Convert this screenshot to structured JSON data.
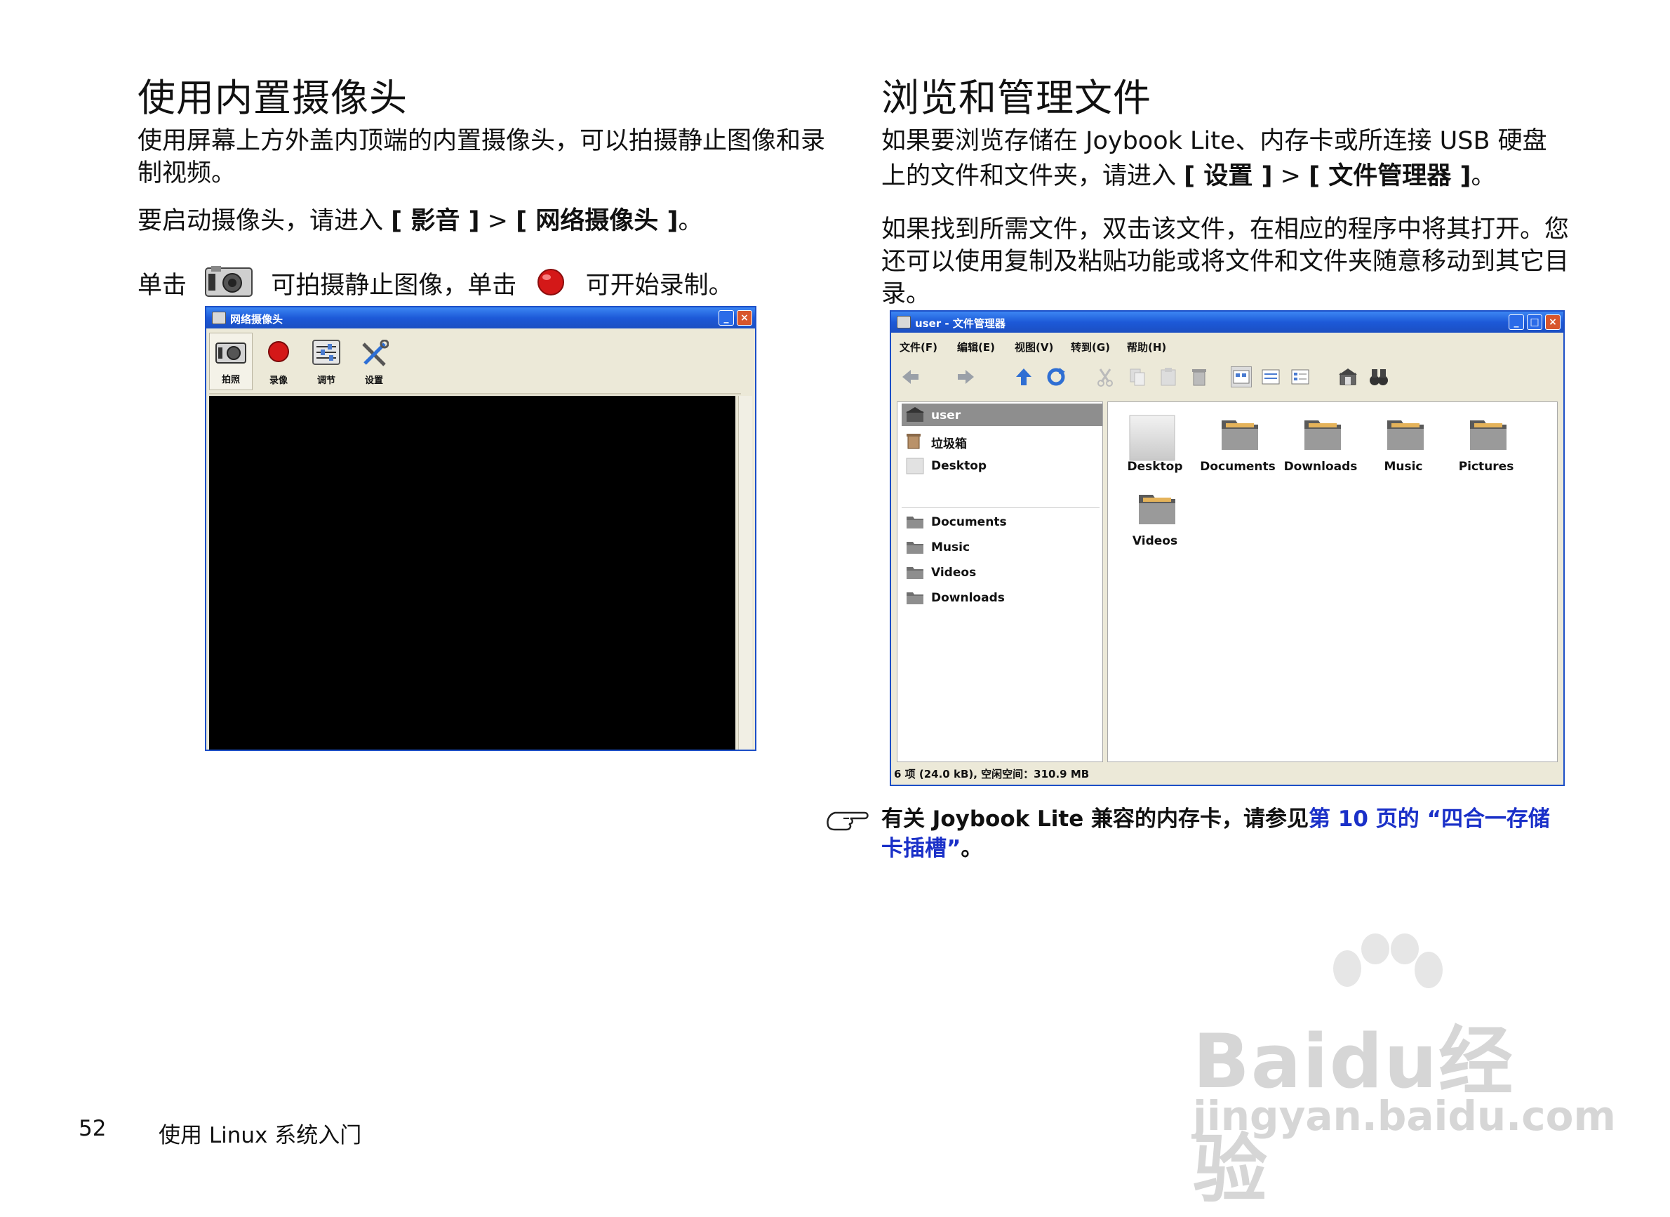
{
  "left": {
    "heading": "使用内置摄像头",
    "intro": "使用屏幕上方外盖内顶端的内置摄像头，可以拍摄静止图像和录制视频。",
    "start_prefix": "要启动摄像头，请进入 ",
    "start_menu_1": "[ 影音 ]",
    "start_sep": " > ",
    "start_menu_2": "[ 网络摄像头 ]",
    "start_suffix": "。",
    "click_1": "单击",
    "click_2": "可拍摄静止图像，单击",
    "click_3": "可开始录制。"
  },
  "webcam_window": {
    "title": "网络摄像头",
    "buttons": [
      "拍照",
      "录像",
      "调节",
      "设置"
    ],
    "colors": {
      "titlebar": "#1d59d8",
      "record": "#d41818",
      "preview": "#000000"
    }
  },
  "right": {
    "heading": "浏览和管理文件",
    "para1_a": "如果要浏览存储在 Joybook Lite、内存卡或所连接 USB 硬盘",
    "para1_b_prefix": "上的文件和文件夹，请进入 ",
    "para1_menu_1": "[ 设置 ]",
    "para1_sep": " > ",
    "para1_menu_2": "[ 文件管理器 ]",
    "para1_suffix": "。",
    "para2": "如果找到所需文件，双击该文件，在相应的程序中将其打开。您还可以使用复制及粘贴功能或将文件和文件夹随意移动到其它目录。"
  },
  "file_manager": {
    "title": "user - 文件管理器",
    "menu": [
      "文件(F)",
      "编辑(E)",
      "视图(V)",
      "转到(G)",
      "帮助(H)"
    ],
    "sidebar_top": [
      "user",
      "垃圾箱",
      "Desktop"
    ],
    "sidebar_bottom": [
      "Documents",
      "Music",
      "Videos",
      "Downloads"
    ],
    "items": [
      "Desktop",
      "Documents",
      "Downloads",
      "Music",
      "Pictures",
      "Videos"
    ],
    "status": "6 项 (24.0 kB), 空闲空间：310.9 MB"
  },
  "note": {
    "text": "有关 Joybook Lite 兼容的内存卡，请参见",
    "link": "第 10 页的 “四合一存储卡插槽”",
    "suffix": "。"
  },
  "footer": {
    "page_number": "52",
    "section": "使用 Linux 系统入门"
  },
  "watermark": {
    "logo": "Baidu经验",
    "url": "jingyan.baidu.com"
  }
}
